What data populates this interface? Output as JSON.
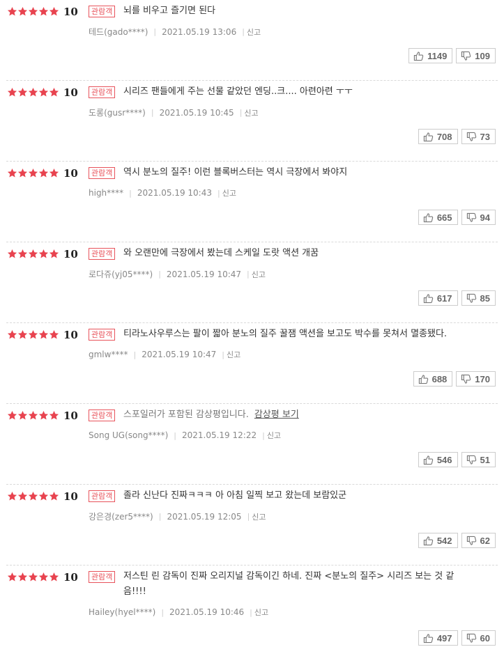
{
  "colors": {
    "star": "#e8434f",
    "badge": "#e8525a"
  },
  "reviews": [
    {
      "score": "10",
      "badge": "관람객",
      "text": "뇌를 비우고 즐기면 된다",
      "user": "테드(gado****)",
      "date": "2021.05.19 13:06",
      "report": "신고",
      "like": "1149",
      "dislike": "109"
    },
    {
      "score": "10",
      "badge": "관람객",
      "text": "시리즈 팬들에게 주는 선물 같았던 엔딩..크.... 아련아련 ㅜㅜ",
      "user": "도롱(gusr****)",
      "date": "2021.05.19 10:45",
      "report": "신고",
      "like": "708",
      "dislike": "73"
    },
    {
      "score": "10",
      "badge": "관람객",
      "text": "역시 분노의 질주! 이런 블록버스터는 역시 극장에서 봐야지",
      "user": "high****",
      "date": "2021.05.19 10:43",
      "report": "신고",
      "like": "665",
      "dislike": "94"
    },
    {
      "score": "10",
      "badge": "관람객",
      "text": "와 오랜만에 극장에서 봤는데 스케일 도랏 액션 개꿈",
      "user": "로다쥬(yj05****)",
      "date": "2021.05.19 10:47",
      "report": "신고",
      "like": "617",
      "dislike": "85"
    },
    {
      "score": "10",
      "badge": "관람객",
      "text": "티라노사우루스는 팔이 짧아 분노의 질주 꿀잼 액션을 보고도 박수를 못쳐서 멸종됐다.",
      "user": "gmlw****",
      "date": "2021.05.19 10:47",
      "report": "신고",
      "like": "688",
      "dislike": "170"
    },
    {
      "score": "10",
      "badge": "관람객",
      "text": "스포일러가 포함된 감상평입니다.",
      "spoiler_link": "감상평 보기",
      "user": "Song UG(song****)",
      "date": "2021.05.19 12:22",
      "report": "신고",
      "like": "546",
      "dislike": "51"
    },
    {
      "score": "10",
      "badge": "관람객",
      "text": "졸라 신난다 진짜ㅋㅋㅋ 아 아침 일찍 보고 왔는데 보람있군",
      "user": "강은경(zer5****)",
      "date": "2021.05.19 12:05",
      "report": "신고",
      "like": "542",
      "dislike": "62"
    },
    {
      "score": "10",
      "badge": "관람객",
      "text": "저스틴 린 감독이 진짜 오리지널 감독이긴 하네. 진짜 <분노의 질주> 시리즈 보는 것 같음!!!!",
      "user": "Hailey(hyel****)",
      "date": "2021.05.19 10:46",
      "report": "신고",
      "like": "497",
      "dislike": "60"
    }
  ]
}
